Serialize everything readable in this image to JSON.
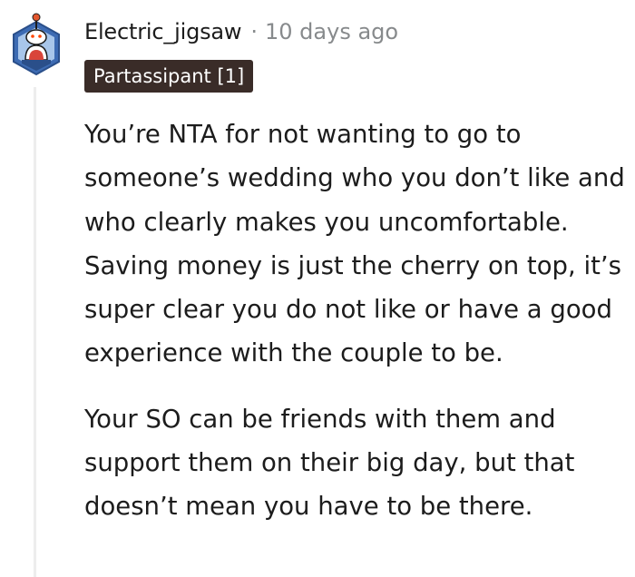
{
  "comment": {
    "author": "Electric_jigsaw",
    "separator": "·",
    "timestamp": "10 days ago",
    "flair": "Partassipant [1]",
    "avatar_icon": "snoo-avatar-icon",
    "paragraphs": [
      "You’re NTA for not wanting to go to someone’s wedding who you don’t like and who clearly makes you uncomfortable. Saving money is just the cherry on top, it’s super clear you do not like or have a good experience with the couple to be.",
      "Your SO can be friends with them and support them on their big day, but that doesn’t mean you have to be there."
    ]
  },
  "colors": {
    "flair_bg": "#3a2c28",
    "flair_text": "#ffffff",
    "meta_gray": "#878a8c",
    "thread_line": "#ededed",
    "avatar_hex": "#3d6bb3"
  }
}
